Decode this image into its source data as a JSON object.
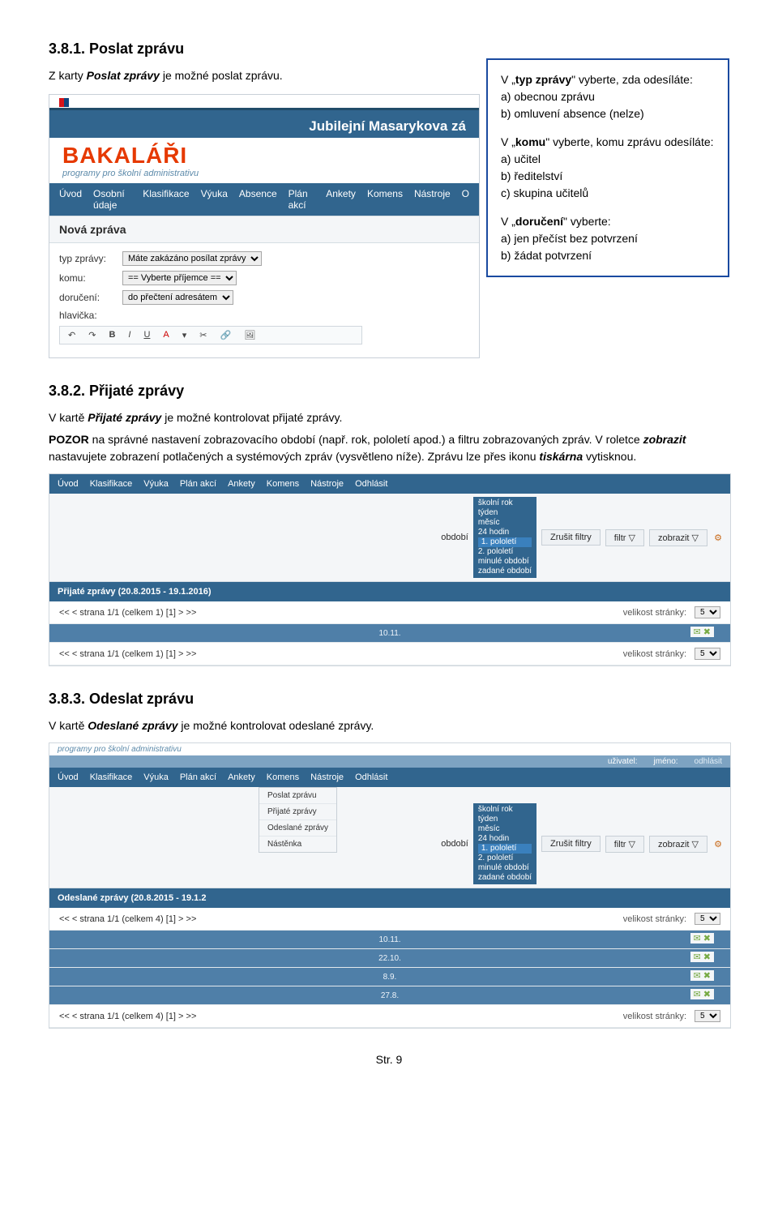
{
  "sec381": {
    "heading": "3.8.1. Poslat zprávu",
    "intro_pre": "Z karty ",
    "intro_emph": "Poslat zprávy",
    "intro_post": " je možné poslat zprávu."
  },
  "callout": {
    "g1_title_pre": "V „",
    "g1_title_b": "typ zprávy",
    "g1_title_post": "\" vyberte, zda odesíláte:",
    "g1_a": "a) obecnou zprávu",
    "g1_b": "b) omluvení absence (nelze)",
    "g2_title_pre": "V „",
    "g2_title_b": "komu",
    "g2_title_post": "\" vyberte, komu zprávu odesíláte:",
    "g2_a": "a) učitel",
    "g2_b": "b) ředitelství",
    "g2_c": "c) skupina učitelů",
    "g3_title_pre": "V „",
    "g3_title_b": "doručení",
    "g3_title_post": "\" vyberte:",
    "g3_a": "a) jen přečíst bez potvrzení",
    "g3_b": "b) žádat potvrzení"
  },
  "shot1": {
    "app_title": "Jubilejní Masarykova zá",
    "logo": "BAKALÁŘI",
    "logo_sub": "programy pro školní administrativu",
    "menu": [
      "Úvod",
      "Osobní údaje",
      "Klasifikace",
      "Výuka",
      "Absence",
      "Plán akcí",
      "Ankety",
      "Komens",
      "Nástroje",
      "O"
    ],
    "panel_title": "Nová zpráva",
    "lab_typ": "typ zprávy:",
    "val_typ": "Máte zakázáno posílat zprávy",
    "lab_komu": "komu:",
    "val_komu": "== Vyberte příjemce ==",
    "lab_doruc": "doručení:",
    "val_doruc": "do přečtení adresátem",
    "lab_hlav": "hlavička:",
    "toolbar": [
      "↶",
      "↷",
      "B",
      "I",
      "U",
      "A",
      "▾",
      "✂",
      "🔗",
      "🖼"
    ]
  },
  "sec382": {
    "heading": "3.8.2. Přijaté zprávy",
    "p1_pre": "V kartě ",
    "p1_emph": "Přijaté zprávy",
    "p1_post": " je možné kontrolovat přijaté zprávy.",
    "p2_b1": "POZOR",
    "p2_mid1": " na správné nastavení zobrazovacího období (např. rok, pololetí apod.) a filtru zobrazovaných zpráv. V roletce ",
    "p2_b2": "zobrazit",
    "p2_mid2": " nastavujete zobrazení potlačených a systémových zpráv (vysvětleno níže). Zprávu lze přes ikonu ",
    "p2_b3": "tiskárna",
    "p2_mid3": " vytisknou."
  },
  "shot2": {
    "menu": [
      "Úvod",
      "Klasifikace",
      "Výuka",
      "Plán akcí",
      "Ankety",
      "Komens",
      "Nástroje",
      "Odhlásit"
    ],
    "obdobi_label": "období",
    "obdobi_opts": [
      "školní rok",
      "týden",
      "měsíc",
      "24 hodin",
      "1. pololetí",
      "2. pololetí",
      "minulé období",
      "zadané období"
    ],
    "obdobi_sel": "1. pololetí",
    "btn_zrusit": "Zrušit filtry",
    "btn_filtr": "filtr ▽",
    "btn_zobrazit": "zobrazit ▽",
    "gear": "⚙",
    "panel_title": "Přijaté zprávy (20.8.2015 - 19.1.2016)",
    "pager_text": "<<   <   strana 1/1 (celkem 1)   [1]   >   >>",
    "velikost": "velikost stránky:",
    "velikost_val": "5",
    "row_date": "10.11.",
    "row_icons": "✉ ✖"
  },
  "sec383": {
    "heading": "3.8.3. Odeslat zprávu",
    "p1_pre": "V kartě ",
    "p1_emph": "Odeslané zprávy",
    "p1_post": " je možné kontrolovat odeslané zprávy."
  },
  "shot3": {
    "logo_sub": "programy pro školní administrativu",
    "userbar_u": "uživatel:",
    "userbar_j": "jméno:",
    "userbar_login": "odhlásit",
    "menu": [
      "Úvod",
      "Klasifikace",
      "Výuka",
      "Plán akcí",
      "Ankety",
      "Komens",
      "Nástroje",
      "Odhlásit"
    ],
    "submenu": [
      "Poslat zprávu",
      "Přijaté zprávy",
      "Odeslané zprávy",
      "Nástěnka"
    ],
    "obdobi_label": "období",
    "obdobi_opts": [
      "školní rok",
      "týden",
      "měsíc",
      "24 hodin",
      "1. pololetí",
      "2. pololetí",
      "minulé období",
      "zadané období"
    ],
    "obdobi_sel": "1. pololetí",
    "btn_zrusit": "Zrušit filtry",
    "btn_filtr": "filtr ▽",
    "btn_zobrazit": "zobrazit ▽",
    "gear": "⚙",
    "panel_title": "Odeslané zprávy (20.8.2015 - 19.1.2",
    "pager_text": "<<   <   strana 1/1 (celkem 4)   [1]   >   >>",
    "velikost": "velikost stránky:",
    "velikost_val": "5",
    "rows": [
      "10.11.",
      "22.10.",
      "8.9.",
      "27.8."
    ],
    "row_icons": "✉ ✖"
  },
  "page_no": "Str. 9"
}
